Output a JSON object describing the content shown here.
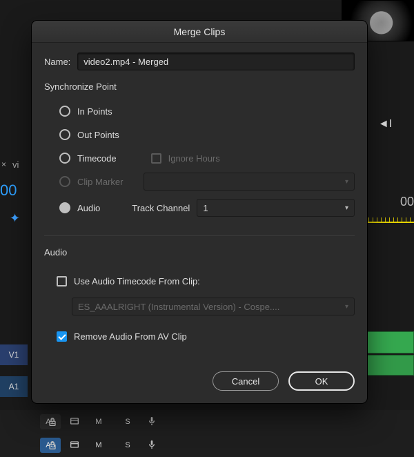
{
  "dialog": {
    "title": "Merge Clips",
    "name_label": "Name:",
    "name_value": "video2.mp4 - Merged",
    "sync": {
      "group_label": "Synchronize Point",
      "in_points": "In Points",
      "out_points": "Out Points",
      "timecode": "Timecode",
      "ignore_hours": "Ignore Hours",
      "clip_marker": "Clip Marker",
      "clip_marker_value": "",
      "audio": "Audio",
      "track_channel_label": "Track Channel",
      "track_channel_value": "1",
      "selected": "audio"
    },
    "audio": {
      "group_label": "Audio",
      "use_timecode_label": "Use Audio Timecode From Clip:",
      "clip_dropdown_value": "ES_AAALRIGHT (Instrumental Version) - Cospe....",
      "remove_audio_label": "Remove Audio From AV Clip",
      "use_timecode_checked": false,
      "remove_audio_checked": true
    },
    "buttons": {
      "cancel": "Cancel",
      "ok": "OK"
    }
  },
  "background": {
    "seq_name_fragment": "vi",
    "x_close": "×",
    "left_time": "00",
    "right_time": "00",
    "tracks": {
      "V1": "V1",
      "A1": "A1",
      "A2": "A2",
      "A3": "A3",
      "M": "M",
      "S": "S"
    },
    "transport": {
      "step_back": "◄I"
    }
  }
}
